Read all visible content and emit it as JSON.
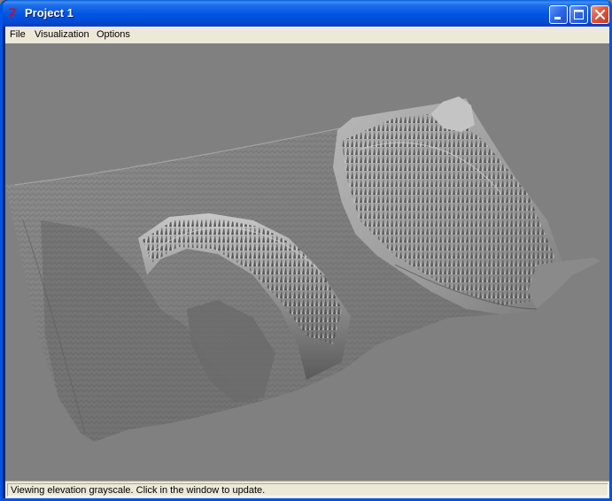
{
  "window": {
    "title": "Project 1",
    "app_icon": "tcl-tk-logo-icon",
    "controls": [
      "minimize-icon",
      "maximize-icon",
      "close-icon"
    ]
  },
  "menu": {
    "items": [
      {
        "label": "File"
      },
      {
        "label": "Visualization"
      },
      {
        "label": "Options"
      }
    ]
  },
  "viewport": {
    "background": "#808080",
    "content": "grayscale-shaded-elevation-terrain-3d"
  },
  "status": {
    "text": "Viewing elevation grayscale. Click in the window to update."
  },
  "colors": {
    "titlebar": "#0054e3",
    "close_button": "#e0563a",
    "menubar": "#ece9d8"
  }
}
